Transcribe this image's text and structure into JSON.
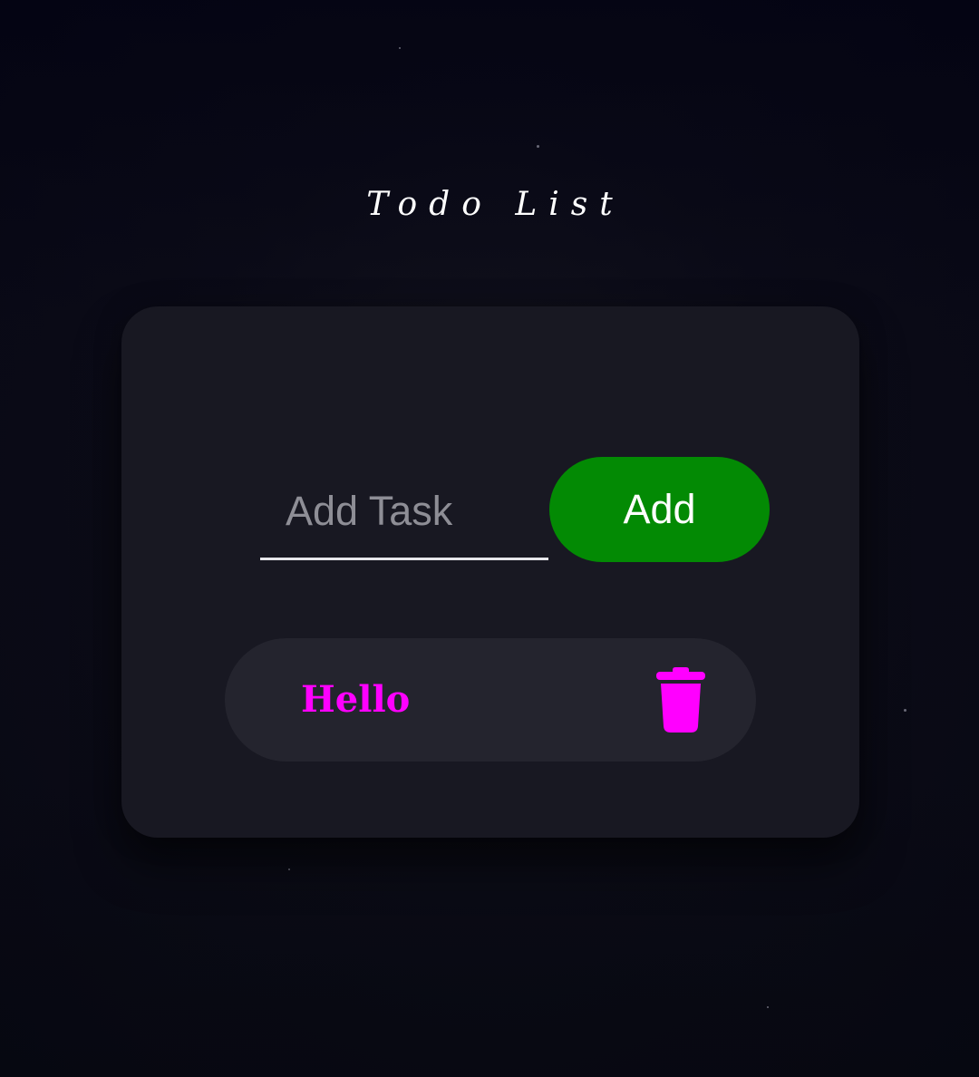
{
  "app": {
    "title": "Todo List"
  },
  "input": {
    "placeholder": "Add Task",
    "value": ""
  },
  "add_button": {
    "label": "Add"
  },
  "tasks": [
    {
      "text": "Hello",
      "delete_icon": "trash-icon"
    }
  ],
  "colors": {
    "background": "#0c0c18",
    "card": "#181822",
    "task_item": "#24242e",
    "accent_green": "#038a04",
    "task_text": "#ff00ff",
    "delete_icon": "#ff00ff",
    "title": "#ffffff"
  }
}
